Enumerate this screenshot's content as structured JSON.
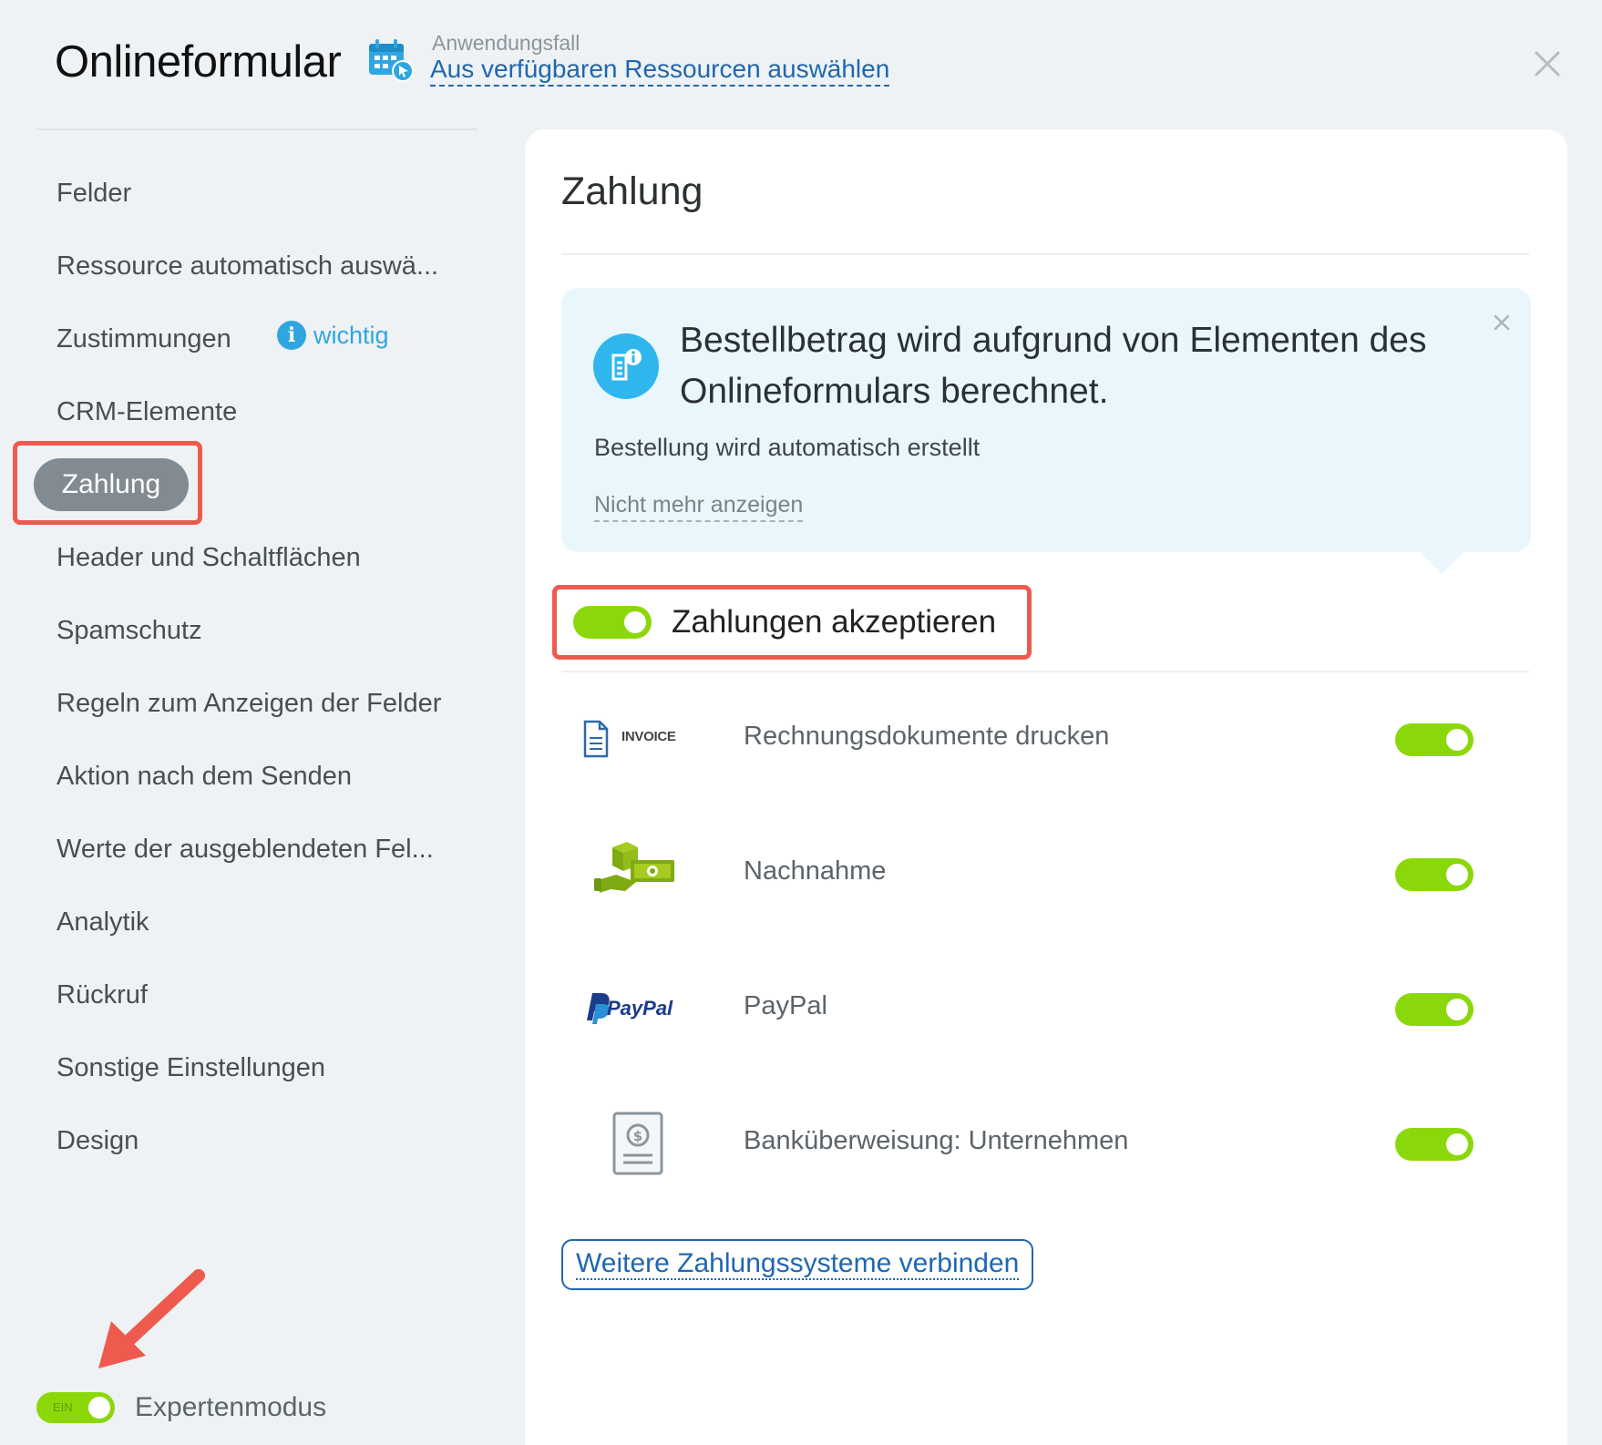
{
  "header": {
    "title": "Onlineformular",
    "usecase_caption": "Anwendungsfall",
    "usecase_link": "Aus verfügbaren Ressourcen auswählen"
  },
  "sidebar": {
    "items": [
      {
        "label": "Felder"
      },
      {
        "label": "Ressource automatisch auswä..."
      },
      {
        "label": "Zustimmungen",
        "badge": "wichtig"
      },
      {
        "label": "CRM-Elemente"
      },
      {
        "label": "Zahlung",
        "active": true
      },
      {
        "label": "Header und Schaltflächen"
      },
      {
        "label": "Spamschutz"
      },
      {
        "label": "Regeln zum Anzeigen der Felder"
      },
      {
        "label": "Aktion nach dem Senden"
      },
      {
        "label": "Werte der ausgeblendeten Fel..."
      },
      {
        "label": "Analytik"
      },
      {
        "label": "Rückruf"
      },
      {
        "label": "Sonstige Einstellungen"
      },
      {
        "label": "Design"
      }
    ],
    "expert_toggle_text": "EIN",
    "expert_label": "Expertenmodus"
  },
  "panel": {
    "title": "Zahlung",
    "info": {
      "title": "Bestellbetrag wird aufgrund von Elementen des Onlineformulars berechnet.",
      "subtitle": "Bestellung wird automatisch erstellt",
      "dismiss": "Nicht mehr anzeigen"
    },
    "accept_label": "Zahlungen akzeptieren",
    "accept_enabled": true,
    "payment_systems": [
      {
        "name": "Rechnungsdokumente drucken",
        "logo_text": "INVOICE",
        "icon": "invoice-icon",
        "enabled": true
      },
      {
        "name": "Nachnahme",
        "icon": "cash-on-delivery-icon",
        "enabled": true
      },
      {
        "name": "PayPal",
        "logo_text": "PayPal",
        "icon": "paypal-logo",
        "enabled": true
      },
      {
        "name": "Banküberweisung: Unternehmen",
        "icon": "bank-transfer-icon",
        "enabled": true
      }
    ],
    "connect_button": "Weitere Zahlungssysteme verbinden"
  },
  "colors": {
    "toggle_on": "#8bd80a",
    "link": "#2067b0",
    "highlight": "#ef5a4e",
    "info_bg": "#e9f7fd",
    "info_icon": "#2fb6ec",
    "active_nav": "#828b91"
  }
}
